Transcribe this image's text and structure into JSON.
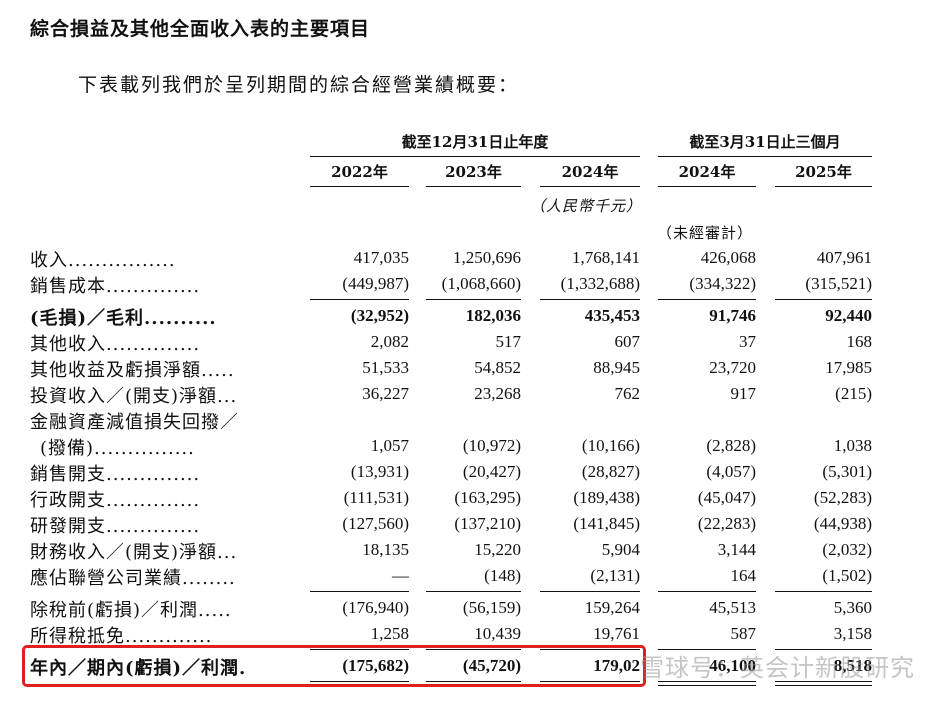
{
  "heading": "綜合損益及其他全面收入表的主要項目",
  "intro": "下表載列我們於呈列期間的綜合經營業績概要：",
  "groups": {
    "annual": "截至12月31日止年度",
    "quarter": "截至3月31日止三個月"
  },
  "columns": [
    "2022年",
    "2023年",
    "2024年",
    "2024年",
    "2025年"
  ],
  "unit_note": "（人民幣千元）",
  "audit_note": "（未經審計）",
  "rows": [
    {
      "label": "收入................",
      "values": [
        "417,035",
        "1,250,696",
        "1,768,141",
        "426,068",
        "407,961"
      ]
    },
    {
      "label": "銷售成本..............",
      "values": [
        "(449,987)",
        "(1,068,660)",
        "(1,332,688)",
        "(334,322)",
        "(315,521)"
      ]
    },
    {
      "label": "(毛損)／毛利..........",
      "values": [
        "(32,952)",
        "182,036",
        "435,453",
        "91,746",
        "92,440"
      ]
    },
    {
      "label": "其他收入..............",
      "values": [
        "2,082",
        "517",
        "607",
        "37",
        "168"
      ]
    },
    {
      "label": "其他收益及虧損淨額.....",
      "values": [
        "51,533",
        "54,852",
        "88,945",
        "23,720",
        "17,985"
      ]
    },
    {
      "label": "投資收入／(開支)淨額...",
      "values": [
        "36,227",
        "23,268",
        "762",
        "917",
        "(215)"
      ]
    },
    {
      "label": "金融資產減值損失回撥／",
      "values": []
    },
    {
      "label": "(撥備)...............",
      "values": [
        "1,057",
        "(10,972)",
        "(10,166)",
        "(2,828)",
        "1,038"
      ]
    },
    {
      "label": "銷售開支..............",
      "values": [
        "(13,931)",
        "(20,427)",
        "(28,827)",
        "(4,057)",
        "(5,301)"
      ]
    },
    {
      "label": "行政開支..............",
      "values": [
        "(111,531)",
        "(163,295)",
        "(189,438)",
        "(45,047)",
        "(52,283)"
      ]
    },
    {
      "label": "研發開支..............",
      "values": [
        "(127,560)",
        "(137,210)",
        "(141,845)",
        "(22,283)",
        "(44,938)"
      ]
    },
    {
      "label": "財務收入／(開支)淨額...",
      "values": [
        "18,135",
        "15,220",
        "5,904",
        "3,144",
        "(2,032)"
      ]
    },
    {
      "label": "應佔聯營公司業績........",
      "values": [
        "—",
        "(148)",
        "(2,131)",
        "164",
        "(1,502)"
      ]
    },
    {
      "label": "除稅前(虧損)／利潤.....",
      "values": [
        "(176,940)",
        "(56,159)",
        "159,264",
        "45,513",
        "5,360"
      ]
    },
    {
      "label": "所得稅抵免.............",
      "values": [
        "1,258",
        "10,439",
        "19,761",
        "587",
        "3,158"
      ]
    },
    {
      "label": "年內／期內(虧損)／利潤.",
      "values": [
        "(175,682)",
        "(45,720)",
        "179,02",
        "46,100",
        "8,518"
      ]
    }
  ],
  "watermark": "雪球号：英会计新股研究"
}
